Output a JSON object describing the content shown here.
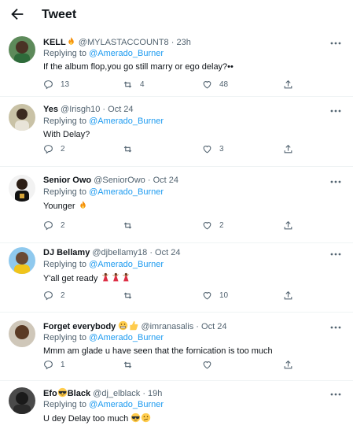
{
  "header": {
    "title": "Tweet"
  },
  "replying_prefix": "Replying to",
  "colors": {
    "link": "#1d9bf0",
    "secondary": "#536471"
  },
  "tweets": [
    {
      "name": "KELL",
      "name_emoji": "fire",
      "handle": "@MYLASTACCOUNT8",
      "dot": "·",
      "time": "23h",
      "reply_to": "@Amerado_Burner",
      "text": "If the album flop,you go still marry or ego delay?••",
      "text_emojis": [],
      "replies": "13",
      "retweets": "4",
      "likes": "48"
    },
    {
      "name": "Yes",
      "name_emoji": "",
      "handle": "@Irisgh10",
      "dot": "·",
      "time": "Oct 24",
      "reply_to": "@Amerado_Burner",
      "text": "With Delay?",
      "text_emojis": [],
      "replies": "2",
      "retweets": "",
      "likes": "3"
    },
    {
      "name": "Senior Owo",
      "name_emoji": "",
      "handle": "@SeniorOwo",
      "dot": "·",
      "time": "Oct 24",
      "reply_to": "@Amerado_Burner",
      "text": "Younger",
      "text_emojis": [
        "fire"
      ],
      "replies": "2",
      "retweets": "",
      "likes": "2"
    },
    {
      "name": "DJ Bellamy",
      "name_emoji": "",
      "handle": "@djbellamy18",
      "dot": "·",
      "time": "Oct 24",
      "reply_to": "@Amerado_Burner",
      "text": "Y'all  get ready",
      "text_emojis": [
        "dancer",
        "dancer",
        "dancer"
      ],
      "replies": "2",
      "retweets": "",
      "likes": "10"
    },
    {
      "name": "Forget everybody",
      "name_emoji": "grin-thumbs",
      "handle": "@imranasalis",
      "dot": "·",
      "time": "Oct 24",
      "reply_to": "@Amerado_Burner",
      "text": "Mmm am glade u have seen that the fornication is too much",
      "text_emojis": [],
      "replies": "1",
      "retweets": "",
      "likes": ""
    },
    {
      "name": "Efo",
      "name_suffix": "Black",
      "name_emoji": "sunglasses",
      "handle": "@dj_elblack",
      "dot": "·",
      "time": "19h",
      "reply_to": "@Amerado_Burner",
      "text": "U dey Delay too much",
      "text_emojis": [
        "sunglasses",
        "confused"
      ],
      "replies": "",
      "retweets": "",
      "likes": ""
    }
  ],
  "icons": {
    "back": "arrow-left-icon",
    "more": "more-icon",
    "reply": "reply-icon",
    "retweet": "retweet-icon",
    "like": "heart-icon",
    "share": "share-icon"
  }
}
